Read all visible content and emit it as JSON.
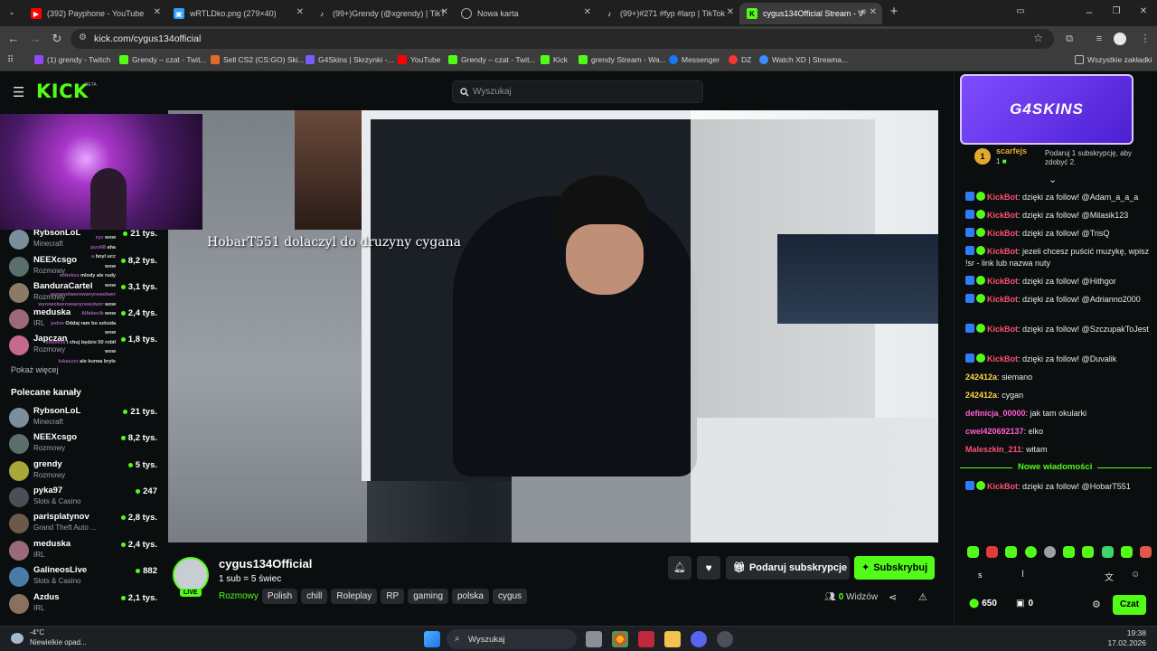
{
  "browser": {
    "tabs": [
      {
        "title": "(392) Payphone - YouTube",
        "icon": "youtube-icon",
        "color": "#ff0000"
      },
      {
        "title": "wRTLDko.png (279×40)",
        "icon": "image-icon",
        "color": "#2fa0ff"
      },
      {
        "title": "(99+)Grendy (@xgrendy) | TikT",
        "icon": "tiktok-icon",
        "color": "#ffffff"
      },
      {
        "title": "Nowa karta",
        "icon": "chrome-icon",
        "color": "#aaaaaa"
      },
      {
        "title": "(99+)#271 #fyp #larp | TikTok",
        "icon": "tiktok-icon",
        "color": "#ffffff"
      },
      {
        "title": "cygus134Official Stream - V",
        "icon": "kick-icon",
        "color": "#53fc18"
      }
    ],
    "url": "kick.com/cygus134official",
    "bookmarks": [
      {
        "label": "(1) grendy - Twitch",
        "color": "#9146ff"
      },
      {
        "label": "Grendy – czat - Twit...",
        "color": "#53fc18"
      },
      {
        "label": "Sell CS2 (CS:GO) Ski...",
        "color": "#e26b2b"
      },
      {
        "label": "G4Skins | Skrzynki -...",
        "color": "#7a5cff"
      },
      {
        "label": "YouTube",
        "color": "#ff0000"
      },
      {
        "label": "Grendy – czat - Twit...",
        "color": "#53fc18"
      },
      {
        "label": "Kick",
        "color": "#53fc18"
      },
      {
        "label": "grendy Stream - Wa...",
        "color": "#53fc18"
      },
      {
        "label": "Messenger",
        "color": "#1877f2"
      },
      {
        "label": "DZ",
        "color": "#ff3333"
      },
      {
        "label": "Watch XD | Streama...",
        "color": "#3a8dff"
      }
    ],
    "all_bookmarks": "Wszystkie zakładki"
  },
  "kick": {
    "logo": "KICK",
    "beta": "BETA",
    "search_placeholder": "Wyszukaj",
    "accent": "#53fc18"
  },
  "sidebar": {
    "following": [
      {
        "name": "RybsonLoL",
        "category": "Minecraft",
        "viewers": "21 tys."
      },
      {
        "name": "NEEXcsgo",
        "category": "Rozmowy",
        "viewers": "8,2 tys."
      },
      {
        "name": "BanduraCartel",
        "category": "Rozmowy",
        "viewers": "3,1 tys."
      },
      {
        "name": "meduska",
        "category": "IRL",
        "viewers": "2,4 tys."
      },
      {
        "name": "Japczan",
        "category": "Rozmowy",
        "viewers": "1,8 tys."
      }
    ],
    "show_more": "Pokaż więcej",
    "recommended_title": "Polecane kanały",
    "recommended": [
      {
        "name": "RybsonLoL",
        "category": "Minecraft",
        "viewers": "21 tys."
      },
      {
        "name": "NEEXcsgo",
        "category": "Rozmowy",
        "viewers": "8,2 tys."
      },
      {
        "name": "grendy",
        "category": "Rozmowy",
        "viewers": "5 tys."
      },
      {
        "name": "pyka97",
        "category": "Slots & Casino",
        "viewers": "247"
      },
      {
        "name": "parisplatynov",
        "category": "Grand Theft Auto ...",
        "viewers": "2,8 tys."
      },
      {
        "name": "meduska",
        "category": "IRL",
        "viewers": "2,4 tys."
      },
      {
        "name": "GalineosLive",
        "category": "Slots & Casino",
        "viewers": "882"
      },
      {
        "name": "Azdus",
        "category": "IRL",
        "viewers": "2,1 tys."
      }
    ],
    "overlay_chat": [
      {
        "user": "xyz",
        "text": "wow"
      },
      {
        "user": "jazo68",
        "text": "aha"
      },
      {
        "user": "a",
        "text": "boyl ucc"
      },
      {
        "user": "",
        "text": "wow"
      },
      {
        "user": "sobekxs",
        "text": "mlody ale rudy"
      },
      {
        "user": "",
        "text": "wow"
      },
      {
        "user": "wyrewolwerowanyrewolwer",
        "text": ""
      },
      {
        "user": "wyrewolwerowanyrewolwer",
        "text": "wow"
      },
      {
        "user": "Alfabeclk",
        "text": "wow"
      },
      {
        "user": "jedno",
        "text": "Oddaj ram bo szkoda"
      },
      {
        "user": "",
        "text": "wow"
      },
      {
        "user": "sobekxs",
        "text": "i chuj będzie 50 robił"
      },
      {
        "user": "",
        "text": "wow"
      },
      {
        "user": "lukaszzz",
        "text": "ale kurwa bryle"
      }
    ]
  },
  "video": {
    "overlay_text": "HobarT551  dolaczyl do druzyny cygana",
    "live_badge": "LIVE"
  },
  "stream_info": {
    "channel": "cygus134Official",
    "sub_goal": "1 sub = 5 świec",
    "category": "Rozmowy",
    "tags": [
      "Polish",
      "chill",
      "Roleplay",
      "RP",
      "gaming",
      "polska",
      "cygus"
    ],
    "gift_sub": "Podaruj subskrypcje",
    "subscribe": "Subskrybuj",
    "viewers_count": "0",
    "viewers_label": "Widzów"
  },
  "chat": {
    "sponsor": "G4SKINS",
    "top_gifter": {
      "rank": "1",
      "name": "scarfejs",
      "count": "1"
    },
    "gift_prompt": "Podaruj 1 subskrypcję, aby zdobyć 2.",
    "messages": [
      {
        "user": "KickBot",
        "text": "dzięki za follow! @Adam_a_a_a",
        "color": "#ff4f72",
        "bot": true
      },
      {
        "user": "KickBot",
        "text": "dzięki za follow! @Milasik123",
        "color": "#ff4f72",
        "bot": true
      },
      {
        "user": "KickBot",
        "text": "dzięki za follow! @TrisQ",
        "color": "#ff4f72",
        "bot": true
      },
      {
        "user": "KickBot",
        "text": "jezeli chcesz puścić muzykę, wpisz !sr - link lub nazwa nuty",
        "color": "#ff4f72",
        "bot": true
      },
      {
        "user": "KickBot",
        "text": "dzięki za follow! @Hithgor",
        "color": "#ff4f72",
        "bot": true
      },
      {
        "user": "KickBot",
        "text": "dzięki za follow! @Adrianno2000",
        "color": "#ff4f72",
        "bot": true
      },
      {
        "user": "KickBot",
        "text": "dzięki za follow! @SzczupakToJest",
        "color": "#ff4f72",
        "bot": true
      },
      {
        "user": "KickBot",
        "text": "dzięki za follow! @Duvalik",
        "color": "#ff4f72",
        "bot": true
      },
      {
        "user": "242412a",
        "text": "siemano",
        "color": "#ffd84a",
        "bot": false
      },
      {
        "user": "242412a",
        "text": "cygan",
        "color": "#ffd84a",
        "bot": false
      },
      {
        "user": "definicja_00000",
        "text": "jak tam okularki",
        "color": "#ff5fd0",
        "bot": false
      },
      {
        "user": "cwel420692137",
        "text": "elko",
        "color": "#ff5fd0",
        "bot": false
      },
      {
        "user": "Maleszkin_211",
        "text": "witam",
        "color": "#ff4f72",
        "bot": false
      }
    ],
    "new_messages": "Nowe wiadomości",
    "new_message": {
      "user": "KickBot",
      "text": "dzięki za follow! @HobarT551",
      "color": "#ff4f72"
    },
    "input_value": "s",
    "points": "650",
    "count2": "0",
    "send": "Czat"
  },
  "taskbar": {
    "weather_temp": "-4°C",
    "weather_text": "Niewielkie opad...",
    "search": "Wyszukaj",
    "time": "19:38",
    "date": "17.02.2026"
  }
}
